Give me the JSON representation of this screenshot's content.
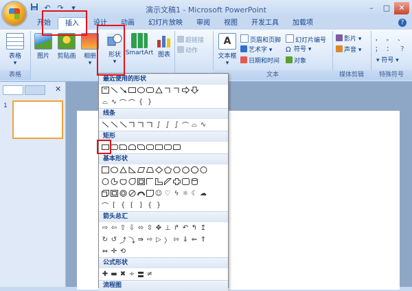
{
  "window": {
    "title": "演示文稿1 - Microsoft PowerPoint",
    "minimize": "–",
    "maximize": "□",
    "close": "✕"
  },
  "quick_access": {
    "save_icon": "save-icon",
    "undo": "↶",
    "redo": "↷",
    "customize": "▾"
  },
  "tabs": [
    "开始",
    "插入",
    "设计",
    "动画",
    "幻灯片放映",
    "审阅",
    "视图",
    "开发工具",
    "加载项"
  ],
  "active_tab": "插入",
  "help": "?",
  "ribbon": {
    "groups": {
      "tables": {
        "label": "表格",
        "table": "表格"
      },
      "illustrations": {
        "picture": "图片",
        "clipart": "剪贴画",
        "album": "相册",
        "shapes": "形状",
        "smartart": "SmartArt",
        "chart": "图表"
      },
      "links": {
        "hyperlink": "超链接",
        "action": "动作"
      },
      "text": {
        "label": "文本",
        "textbox": "文本框",
        "header_footer": "页眉和页脚",
        "wordart": "艺术字",
        "datetime": "日期和时间",
        "slide_number": "幻灯片编号",
        "symbol": "符号",
        "object": "对象"
      },
      "media": {
        "label": "媒体剪辑",
        "movie": "影片",
        "sound": "声音"
      },
      "special": {
        "label": "特殊符号",
        "symbol": "符号",
        "punct1": "，",
        "punct2": "。",
        "punct3": "、",
        "punct4": "；",
        "punct5": "：",
        "punct6": "？"
      }
    },
    "colors": {
      "picture": "#3b8ed8",
      "clipart": "#5aa02c",
      "shapes": "#e9edf3",
      "smartart": "#2e9e4f",
      "chart": "#4a76c0",
      "wordart": "#2f6fc9"
    }
  },
  "dropdown": {
    "sections": [
      "最近使用的形状",
      "线条",
      "矩形",
      "基本形状",
      "箭头总汇",
      "公式形状",
      "流程图"
    ]
  },
  "slides": {
    "number": "1"
  }
}
